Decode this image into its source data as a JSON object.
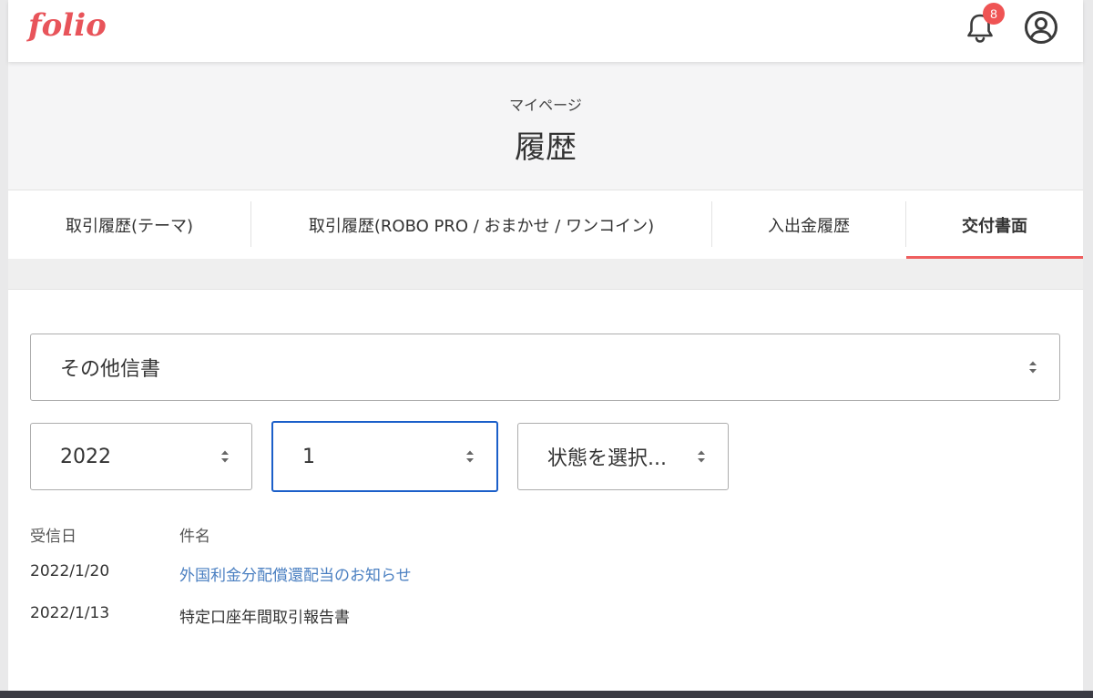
{
  "header": {
    "logo": "folio",
    "notification_count": "8"
  },
  "page_header": {
    "subtitle": "マイページ",
    "title": "履歴"
  },
  "tabs": [
    {
      "label": "取引履歴(テーマ)",
      "active": false
    },
    {
      "label": "取引履歴(ROBO PRO / おまかせ / ワンコイン)",
      "active": false
    },
    {
      "label": "入出金履歴",
      "active": false
    },
    {
      "label": "交付書面",
      "active": true
    }
  ],
  "filters": {
    "document_type": "その他信書",
    "year": "2022",
    "month": "1",
    "status": "状態を選択..."
  },
  "list": {
    "headers": {
      "date": "受信日",
      "subject": "件名"
    },
    "rows": [
      {
        "date": "2022/1/20",
        "subject": "外国利金分配償還配当のお知らせ",
        "link": true
      },
      {
        "date": "2022/1/13",
        "subject": "特定口座年間取引報告書",
        "link": false
      }
    ]
  },
  "colors": {
    "brand": "#e8545a",
    "tab_underline": "#ef5e5e",
    "link": "#4a7fc1",
    "focus": "#1b5fc9"
  }
}
